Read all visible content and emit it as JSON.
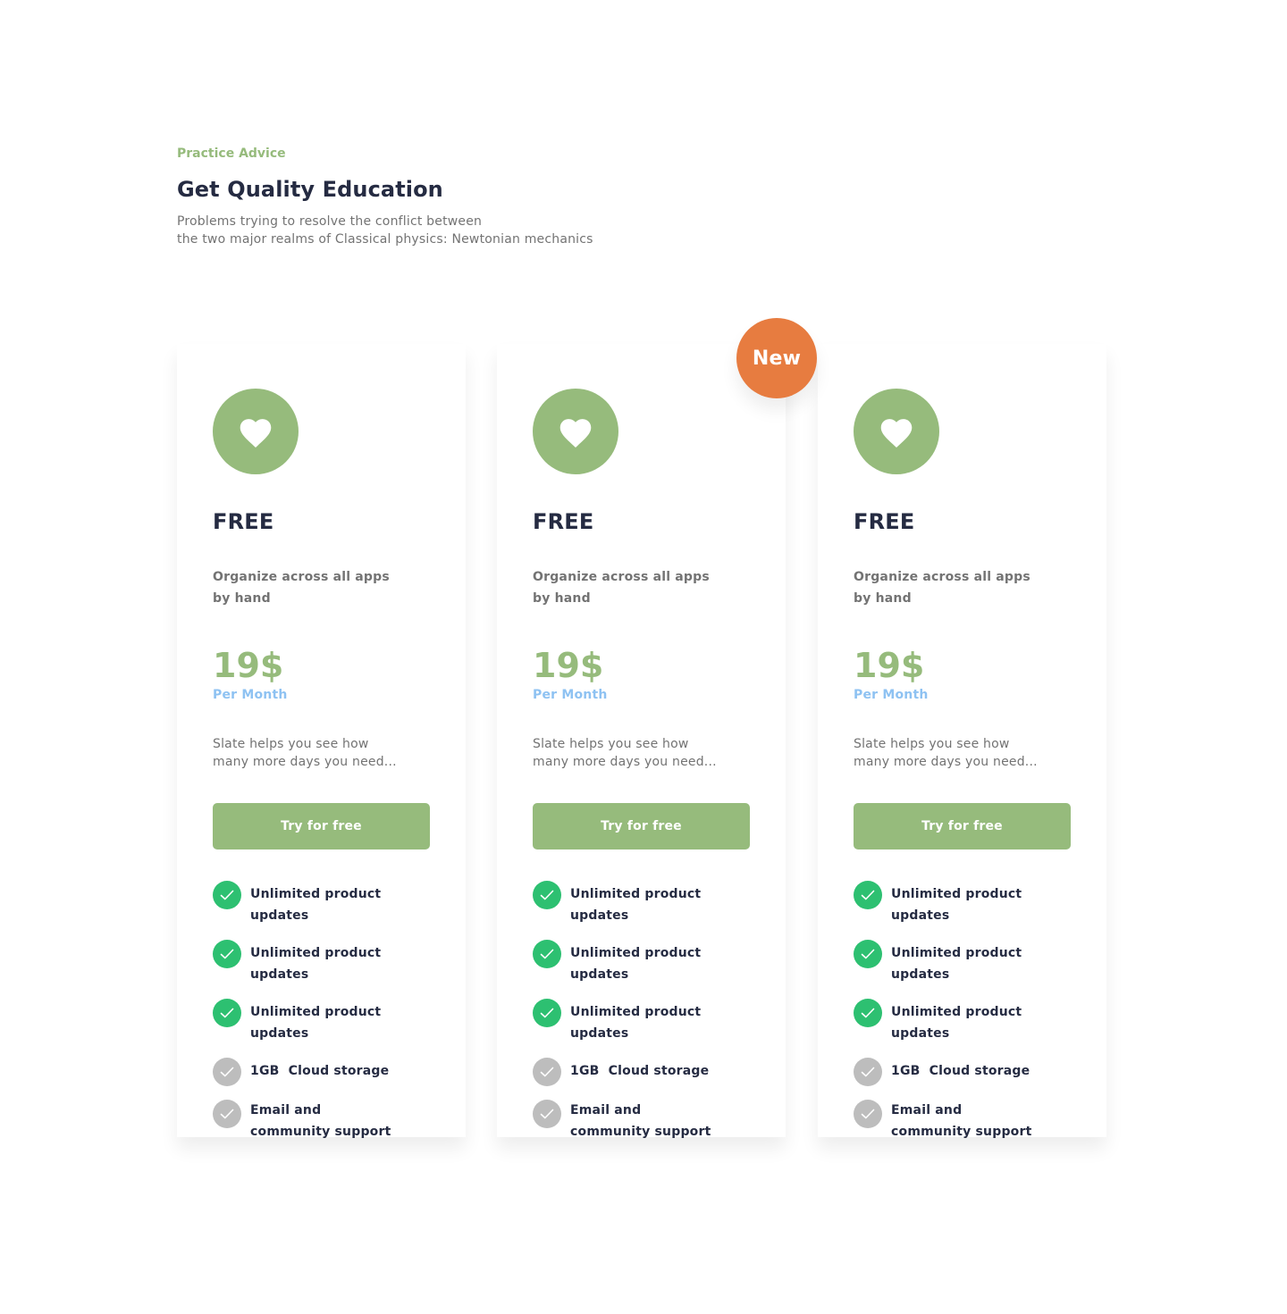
{
  "header": {
    "eyebrow": "Practice Advice",
    "title": "Get Quality Education",
    "subtitle_line1": "Problems trying to resolve the conflict between",
    "subtitle_line2": "the two major realms of Classical physics: Newtonian mechanics"
  },
  "badge": "New",
  "colors": {
    "primary": "#96bb7c",
    "heading": "#252b42",
    "muted": "#737373",
    "accent_blue": "#8ec2f2",
    "check_on": "#2dc071",
    "check_off": "#bdbdbd",
    "badge": "#e77c40"
  },
  "cards": [
    {
      "icon": "heart-icon",
      "name": "FREE",
      "description": "Organize across all apps by hand",
      "price": "19$",
      "period": "Per Month",
      "note_line1": "Slate helps you see how",
      "note_line2": "many more days you need...",
      "cta": "Try for free",
      "features": [
        {
          "label": "Unlimited product updates",
          "included": true
        },
        {
          "label": "Unlimited product updates",
          "included": true
        },
        {
          "label": "Unlimited product updates",
          "included": true
        },
        {
          "label": "1GB  Cloud storage",
          "included": false
        },
        {
          "label": "Email and community support",
          "included": false
        }
      ]
    },
    {
      "icon": "heart-icon",
      "name": "FREE",
      "description": "Organize across all apps by hand",
      "price": "19$",
      "period": "Per Month",
      "note_line1": "Slate helps you see how",
      "note_line2": "many more days you need...",
      "cta": "Try for free",
      "features": [
        {
          "label": "Unlimited product updates",
          "included": true
        },
        {
          "label": "Unlimited product updates",
          "included": true
        },
        {
          "label": "Unlimited product updates",
          "included": true
        },
        {
          "label": "1GB  Cloud storage",
          "included": false
        },
        {
          "label": "Email and community support",
          "included": false
        }
      ]
    },
    {
      "icon": "heart-icon",
      "name": "FREE",
      "description": "Organize across all apps by hand",
      "price": "19$",
      "period": "Per Month",
      "note_line1": "Slate helps you see how",
      "note_line2": "many more days you need...",
      "cta": "Try for free",
      "features": [
        {
          "label": "Unlimited product updates",
          "included": true
        },
        {
          "label": "Unlimited product updates",
          "included": true
        },
        {
          "label": "Unlimited product updates",
          "included": true
        },
        {
          "label": "1GB  Cloud storage",
          "included": false
        },
        {
          "label": "Email and community support",
          "included": false
        }
      ]
    }
  ]
}
